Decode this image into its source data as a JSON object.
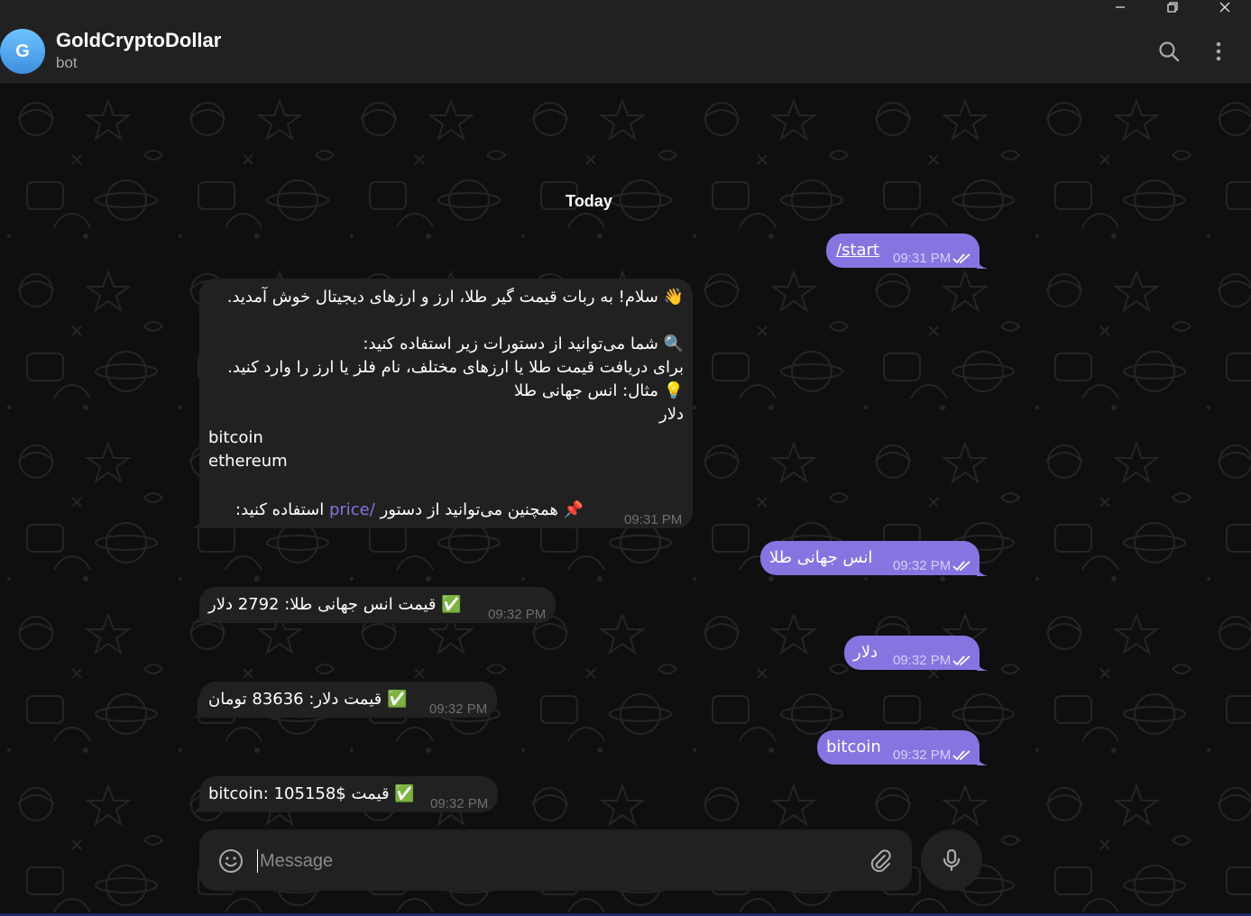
{
  "header": {
    "avatar_letter": "G",
    "title": "GoldCryptoDollar",
    "status": "bot"
  },
  "icons": {
    "search": "search-icon",
    "more": "more-vertical-icon",
    "minimize": "minimize-icon",
    "restore": "restore-icon",
    "close": "close-icon",
    "emoji": "emoji-icon",
    "attach": "paperclip-icon",
    "mic": "microphone-icon",
    "read": "double-check-icon"
  },
  "colors": {
    "accent": "#8774e1",
    "background": "#0f0f0f",
    "panel": "#212121"
  },
  "date_separator": "Today",
  "messages": [
    {
      "id": "m1",
      "direction": "out",
      "text": "/start",
      "time": "09:31 PM",
      "read": true
    },
    {
      "id": "m2",
      "direction": "in",
      "time": "09:31 PM",
      "lines": {
        "l1": "👋 سلام! به ربات قیمت گیر طلا، ارز و ارزهای دیجیتال خوش آمدید.",
        "l2": "🔍 شما می‌توانید از دستورات زیر استفاده کنید:",
        "l3": "برای دریافت قیمت طلا یا ارزهای مختلف، نام فلز یا ارز را وارد کنید.",
        "l4": "💡 مثال: انس جهانی طلا",
        "l5": "دلار",
        "l6": "bitcoin",
        "l7": "ethereum",
        "l8a": "📌 همچنین می‌توانید از دستور",
        "l8_cmd": "/price",
        "l8b": "استفاده کنید:"
      }
    },
    {
      "id": "m3",
      "direction": "out",
      "text": "انس جهانی طلا",
      "time": "09:32 PM",
      "read": true
    },
    {
      "id": "m4",
      "direction": "in",
      "text": "✅ قیمت انس جهانی طلا: 2792 دلار",
      "time": "09:32 PM"
    },
    {
      "id": "m5",
      "direction": "out",
      "text": "دلار",
      "time": "09:32 PM",
      "read": true
    },
    {
      "id": "m6",
      "direction": "in",
      "text": "✅ قیمت دلار: 83636 تومان",
      "time": "09:32 PM"
    },
    {
      "id": "m7",
      "direction": "out",
      "text": "bitcoin",
      "time": "09:32 PM",
      "read": true
    },
    {
      "id": "m8",
      "direction": "in",
      "text": "✅ قیمت bitcoin: 105158$",
      "time": "09:32 PM"
    }
  ],
  "composer": {
    "placeholder": "Message"
  }
}
